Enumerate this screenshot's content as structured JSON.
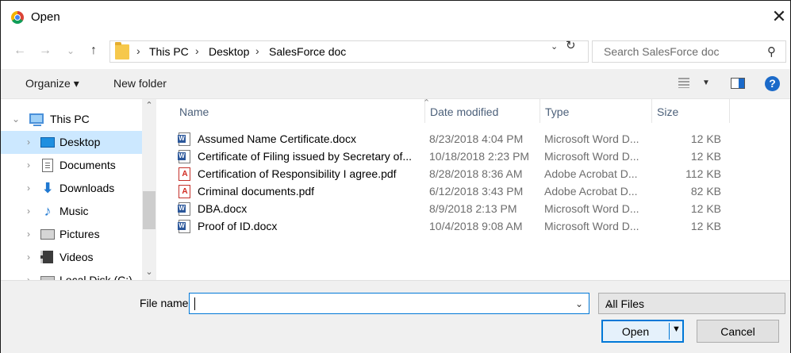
{
  "window": {
    "title": "Open",
    "close_glyph": "✕",
    "app_icon": "chrome-icon"
  },
  "address": {
    "back_glyph": "←",
    "forward_glyph": "→",
    "recent_glyph": "⌄",
    "up_glyph": "↑",
    "crumbs": [
      "This PC",
      "Desktop",
      "SalesForce doc"
    ],
    "separator": "›",
    "dropdown_glyph": "⌄",
    "refresh_glyph": "↻"
  },
  "search": {
    "placeholder": "Search SalesForce doc",
    "icon_glyph": "⚲"
  },
  "toolbar": {
    "organize_label": "Organize ▾",
    "new_folder_label": "New folder",
    "view_dropdown_glyph": "▼",
    "help_glyph": "?"
  },
  "nav": {
    "items": [
      {
        "label": "This PC",
        "icon": "computer-icon",
        "chev": "⌄"
      },
      {
        "label": "Desktop",
        "icon": "desktop-icon",
        "chev": "›",
        "selected": true
      },
      {
        "label": "Documents",
        "icon": "documents-icon",
        "chev": "›"
      },
      {
        "label": "Downloads",
        "icon": "downloads-icon",
        "chev": "›"
      },
      {
        "label": "Music",
        "icon": "music-icon",
        "chev": "›"
      },
      {
        "label": "Pictures",
        "icon": "pictures-icon",
        "chev": "›"
      },
      {
        "label": "Videos",
        "icon": "videos-icon",
        "chev": "›"
      },
      {
        "label": "Local Disk (C:)",
        "icon": "disk-icon",
        "chev": "›"
      }
    ],
    "scroll_up": "⌃",
    "scroll_down": "⌄"
  },
  "files": {
    "columns": [
      "Name",
      "Date modified",
      "Type",
      "Size"
    ],
    "sort_glyph": "⌃",
    "rows": [
      {
        "name": "Assumed Name Certificate.docx",
        "date": "8/23/2018 4:04 PM",
        "type": "Microsoft Word D...",
        "size": "12 KB",
        "kind": "word"
      },
      {
        "name": "Certificate of Filing issued by Secretary of...",
        "date": "10/18/2018 2:23 PM",
        "type": "Microsoft Word D...",
        "size": "12 KB",
        "kind": "word"
      },
      {
        "name": "Certification of Responsibility I agree.pdf",
        "date": "8/28/2018 8:36 AM",
        "type": "Adobe Acrobat D...",
        "size": "112 KB",
        "kind": "pdf"
      },
      {
        "name": "Criminal documents.pdf",
        "date": "6/12/2018 3:43 PM",
        "type": "Adobe Acrobat D...",
        "size": "82 KB",
        "kind": "pdf"
      },
      {
        "name": "DBA.docx",
        "date": "8/9/2018 2:13 PM",
        "type": "Microsoft Word D...",
        "size": "12 KB",
        "kind": "word"
      },
      {
        "name": "Proof of ID.docx",
        "date": "10/4/2018 9:08 AM",
        "type": "Microsoft Word D...",
        "size": "12 KB",
        "kind": "word"
      }
    ]
  },
  "bottom": {
    "file_name_label": "File name:",
    "file_name_value": "",
    "file_name_dropdown_glyph": "⌄",
    "file_type": "All Files",
    "file_type_dropdown_glyph": "⌄",
    "open_label": "Open",
    "open_split_glyph": "▼",
    "cancel_label": "Cancel"
  }
}
